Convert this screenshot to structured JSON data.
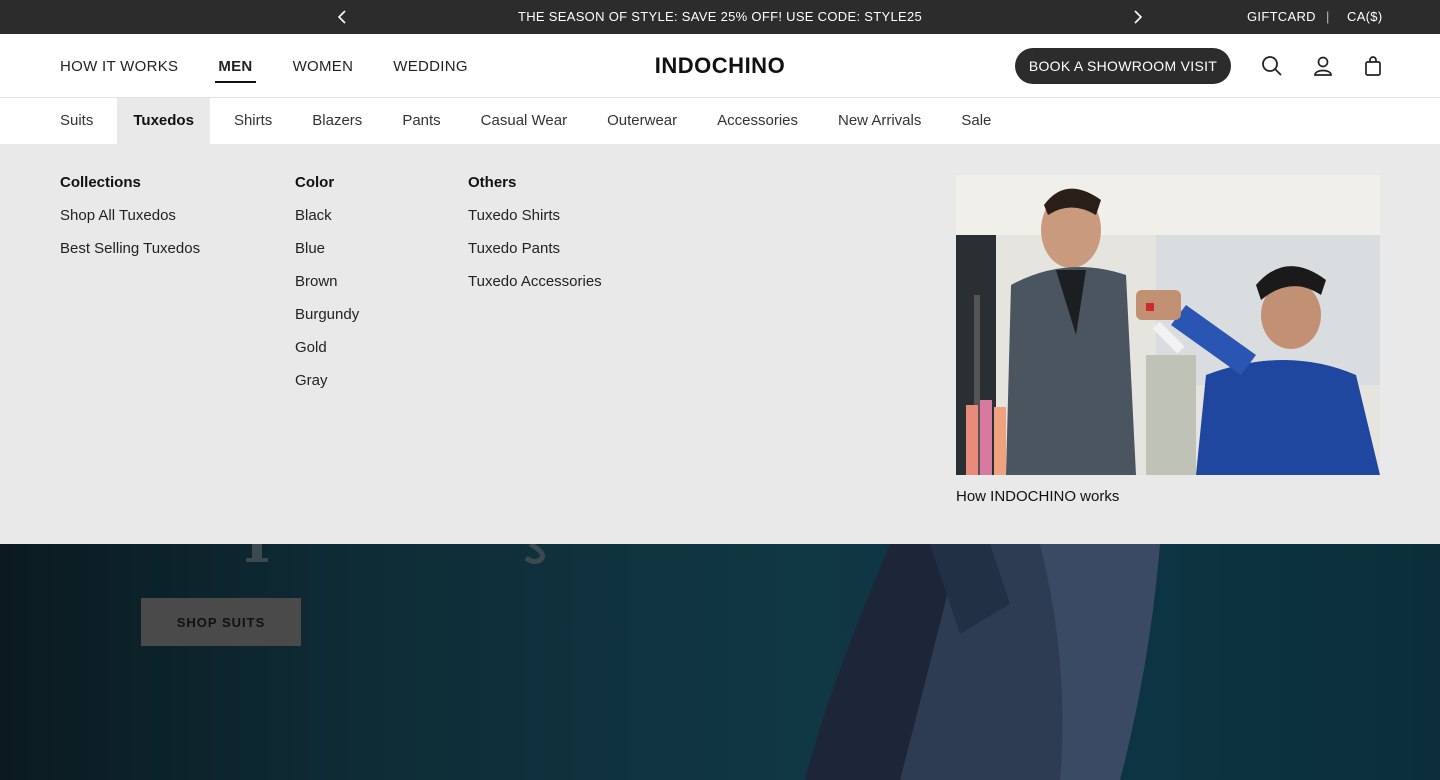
{
  "promo": {
    "message": "THE SEASON OF STYLE: SAVE 25% OFF! USE CODE: STYLE25",
    "giftcard": "GIFTCARD",
    "separator": "|",
    "currency": "CA($)"
  },
  "header": {
    "nav": [
      "HOW IT WORKS",
      "MEN",
      "WOMEN",
      "WEDDING"
    ],
    "active_nav": "MEN",
    "logo": "INDOCHINO",
    "book_button": "BOOK A SHOWROOM VISIT"
  },
  "subnav": {
    "items": [
      "Suits",
      "Tuxedos",
      "Shirts",
      "Blazers",
      "Pants",
      "Casual Wear",
      "Outerwear",
      "Accessories",
      "New Arrivals",
      "Sale"
    ],
    "active": "Tuxedos"
  },
  "mega": {
    "collections": {
      "heading": "Collections",
      "links": [
        "Shop All Tuxedos",
        "Best Selling Tuxedos"
      ]
    },
    "color": {
      "heading": "Color",
      "links": [
        "Black",
        "Blue",
        "Brown",
        "Burgundy",
        "Gold",
        "Gray"
      ]
    },
    "others": {
      "heading": "Others",
      "links": [
        "Tuxedo Shirts",
        "Tuxedo Pants",
        "Tuxedo Accessories"
      ]
    },
    "promo_caption": "How INDOCHINO works"
  },
  "hero": {
    "cta": "SHOP SUITS"
  },
  "colors": {
    "promo_bar": "#2c2c2c",
    "mega_bg": "#e9e9e9",
    "hero_bg": "#0e3442"
  }
}
